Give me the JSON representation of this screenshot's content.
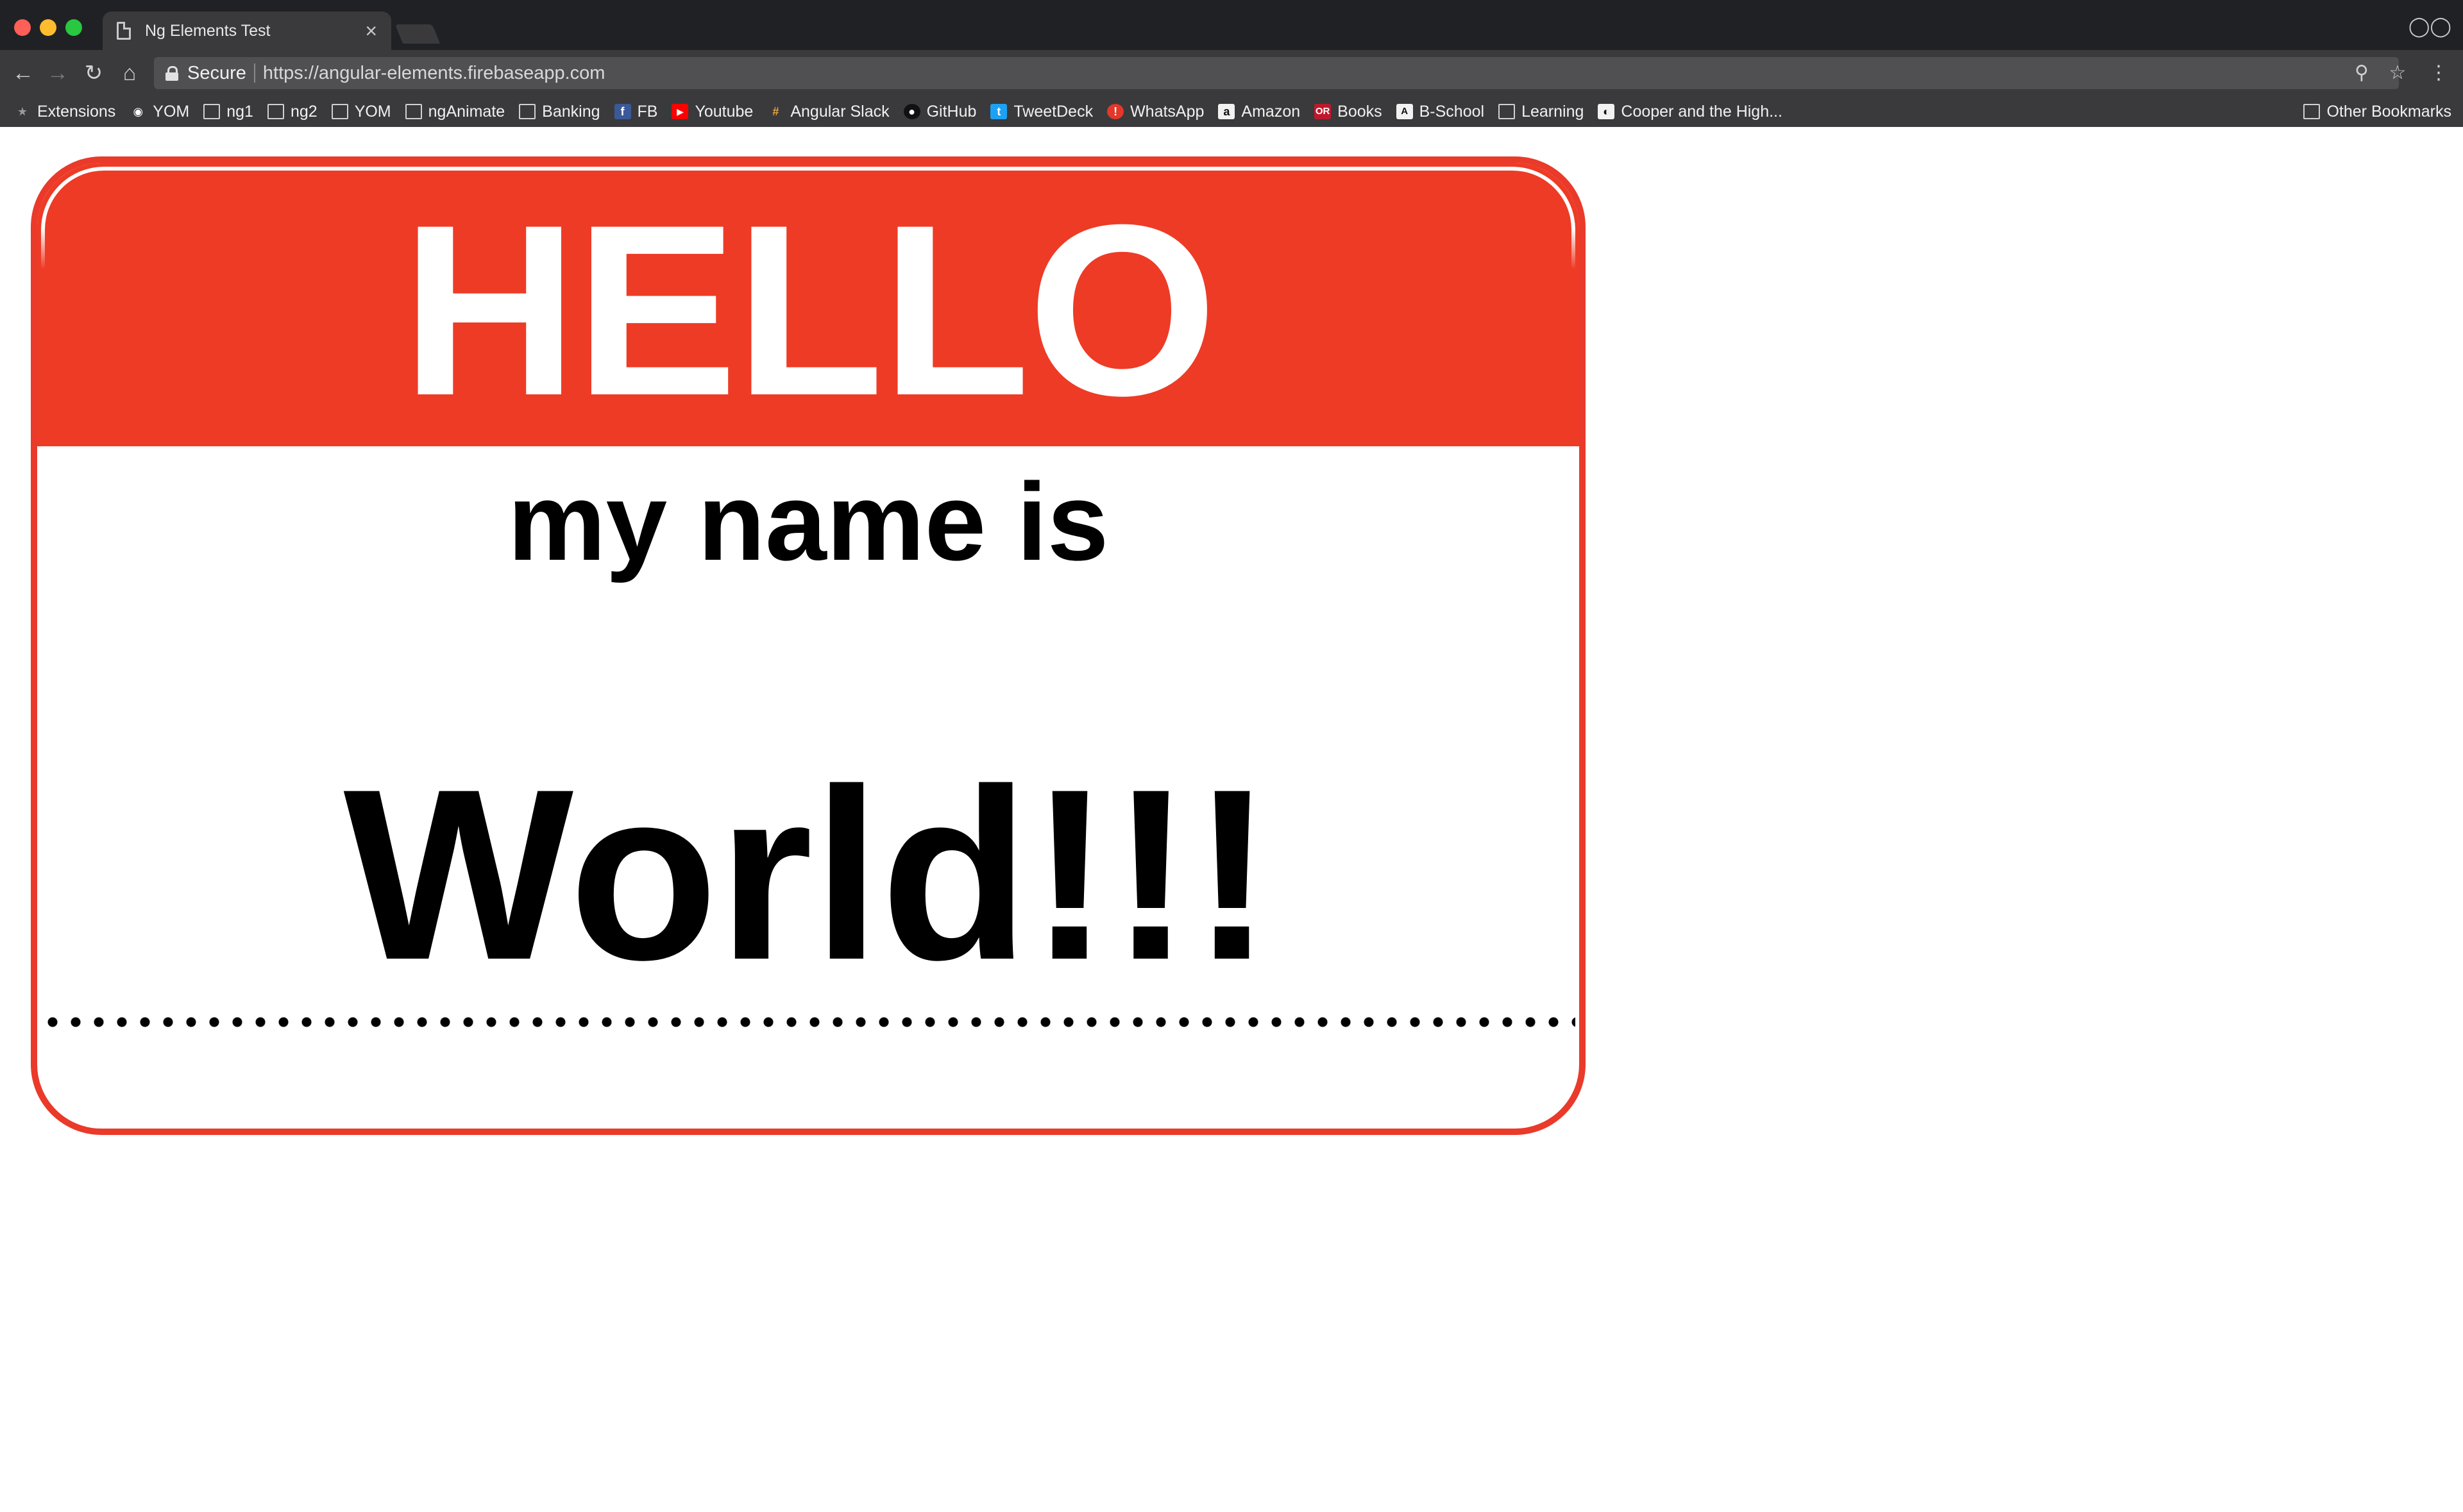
{
  "browser": {
    "tab_title": "Ng Elements Test",
    "tab_close": "×",
    "secure_label": "Secure",
    "url": "https://angular-elements.firebaseapp.com",
    "icons": [
      "back-icon",
      "forward-icon",
      "reload-icon",
      "home-icon",
      "lock-icon",
      "zoom-icon",
      "star-icon",
      "menu-icon",
      "incognito-icon"
    ]
  },
  "bookmarks": {
    "items": [
      {
        "label": "Extensions",
        "icon": "puzzle-icon"
      },
      {
        "label": "YOM",
        "icon": "bot-icon"
      },
      {
        "label": "ng1",
        "icon": "folder-icon"
      },
      {
        "label": "ng2",
        "icon": "folder-icon"
      },
      {
        "label": "YOM",
        "icon": "folder-icon"
      },
      {
        "label": "ngAnimate",
        "icon": "folder-icon"
      },
      {
        "label": "Banking",
        "icon": "folder-icon"
      },
      {
        "label": "FB",
        "icon": "facebook-icon"
      },
      {
        "label": "Youtube",
        "icon": "youtube-icon"
      },
      {
        "label": "Angular Slack",
        "icon": "slack-icon"
      },
      {
        "label": "GitHub",
        "icon": "github-icon"
      },
      {
        "label": "TweetDeck",
        "icon": "tweetdeck-icon"
      },
      {
        "label": "WhatsApp",
        "icon": "whatsapp-icon"
      },
      {
        "label": "Amazon",
        "icon": "amazon-icon"
      },
      {
        "label": "Books",
        "icon": "books-icon"
      },
      {
        "label": "B-School",
        "icon": "bschool-icon"
      },
      {
        "label": "Learning",
        "icon": "folder-icon"
      },
      {
        "label": "Cooper and the High...",
        "icon": "cooper-icon"
      }
    ],
    "other": "Other Bookmarks"
  },
  "badge": {
    "hello": "HELLO",
    "subtitle": "my name is",
    "name": "World!!!",
    "colors": {
      "header": "#ee3b26",
      "border": "#ea3a2a",
      "text": "#000000"
    }
  }
}
